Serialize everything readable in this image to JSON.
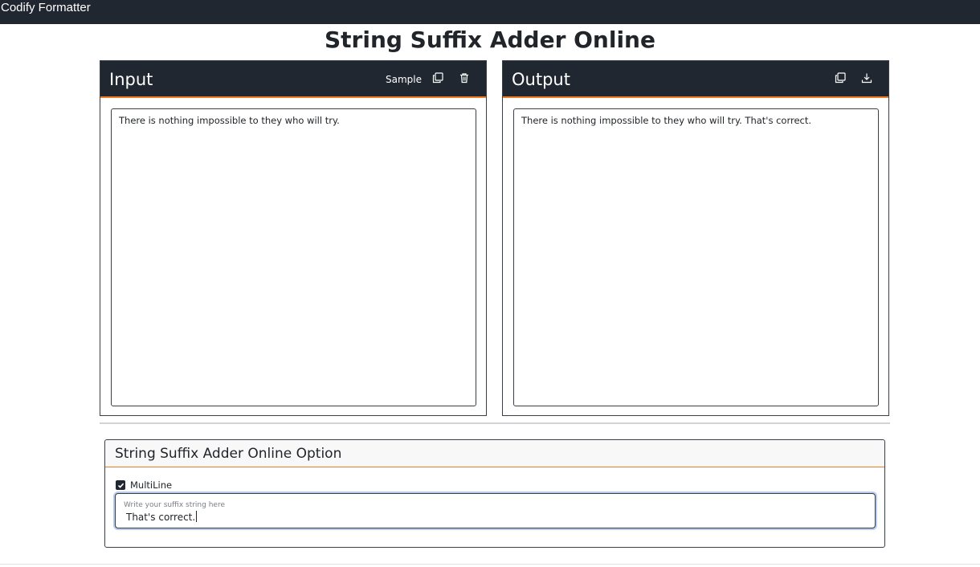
{
  "app": {
    "title": "Codify Formatter"
  },
  "page": {
    "title": "String Suffix Adder Online"
  },
  "input_panel": {
    "title": "Input",
    "sample_label": "Sample",
    "copy_icon": "copy-icon",
    "delete_icon": "trash-icon",
    "text": "There is nothing impossible to they who will try."
  },
  "output_panel": {
    "title": "Output",
    "copy_icon": "copy-icon",
    "download_icon": "download-icon",
    "text": "There is nothing impossible to they who will try. That's correct."
  },
  "options": {
    "title": "String Suffix Adder Online Option",
    "multiline_label": "MultiLine",
    "multiline_checked": true,
    "suffix_placeholder": "Write your suffix string here",
    "suffix_value": "That's correct."
  },
  "colors": {
    "header_bg": "#212731",
    "accent": "#f07c23",
    "text": "#212529"
  }
}
